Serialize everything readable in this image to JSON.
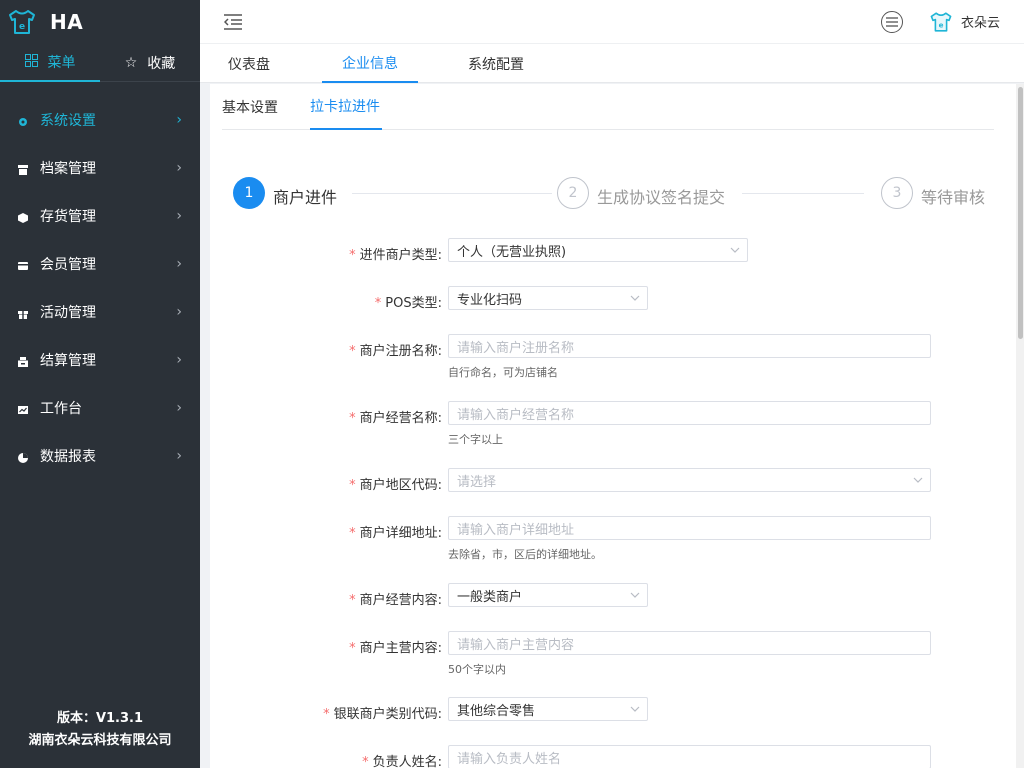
{
  "app": {
    "name": "HA"
  },
  "colors": {
    "accent": "#1fb5d6",
    "primary": "#1a8cf0",
    "sidebar_bg": "#2b3138",
    "required": "#f56c6c"
  },
  "sidebar": {
    "tabs": [
      {
        "label": "菜单",
        "icon": "grid-icon",
        "active": true
      },
      {
        "label": "收藏",
        "icon": "star-icon",
        "active": false
      }
    ],
    "items": [
      {
        "label": "系统设置",
        "icon": "settings-icon",
        "active": true
      },
      {
        "label": "档案管理",
        "icon": "archive-icon"
      },
      {
        "label": "存货管理",
        "icon": "cube-icon"
      },
      {
        "label": "会员管理",
        "icon": "card-icon"
      },
      {
        "label": "活动管理",
        "icon": "gift-icon"
      },
      {
        "label": "结算管理",
        "icon": "register-icon"
      },
      {
        "label": "工作台",
        "icon": "workbench-icon"
      },
      {
        "label": "数据报表",
        "icon": "pie-icon"
      }
    ],
    "footer": {
      "version": "版本：V1.3.1",
      "company": "湖南衣朵云科技有限公司"
    }
  },
  "header": {
    "user_name": "衣朵云"
  },
  "top_tabs": [
    {
      "label": "仪表盘",
      "active": false
    },
    {
      "label": "企业信息",
      "active": true
    },
    {
      "label": "系统配置",
      "active": false
    }
  ],
  "sub_tabs": [
    {
      "label": "基本设置",
      "active": false
    },
    {
      "label": "拉卡拉进件",
      "active": true
    }
  ],
  "steps": [
    {
      "number": "1",
      "label": "商户进件",
      "status": "active"
    },
    {
      "number": "2",
      "label": "生成协议签名提交",
      "status": "pending"
    },
    {
      "number": "3",
      "label": "等待审核",
      "status": "pending"
    }
  ],
  "form": {
    "fields": [
      {
        "label": "进件商户类型:",
        "type": "select",
        "value": "个人（无营业执照)"
      },
      {
        "label": "POS类型:",
        "type": "select",
        "value": "专业化扫码"
      },
      {
        "label": "商户注册名称:",
        "type": "input",
        "placeholder": "请输入商户注册名称",
        "hint": "自行命名，可为店铺名"
      },
      {
        "label": "商户经营名称:",
        "type": "input",
        "placeholder": "请输入商户经营名称",
        "hint": "三个字以上"
      },
      {
        "label": "商户地区代码:",
        "type": "select",
        "placeholder": "请选择"
      },
      {
        "label": "商户详细地址:",
        "type": "input",
        "placeholder": "请输入商户详细地址",
        "hint": "去除省，市，区后的详细地址。"
      },
      {
        "label": "商户经营内容:",
        "type": "select",
        "value": "一般类商户"
      },
      {
        "label": "商户主营内容:",
        "type": "input",
        "placeholder": "请输入商户主营内容",
        "hint": "50个字以内"
      },
      {
        "label": "银联商户类别代码:",
        "type": "select",
        "value": "其他综合零售"
      },
      {
        "label": "负责人姓名:",
        "type": "input",
        "placeholder": "请输入负责人姓名"
      }
    ]
  }
}
